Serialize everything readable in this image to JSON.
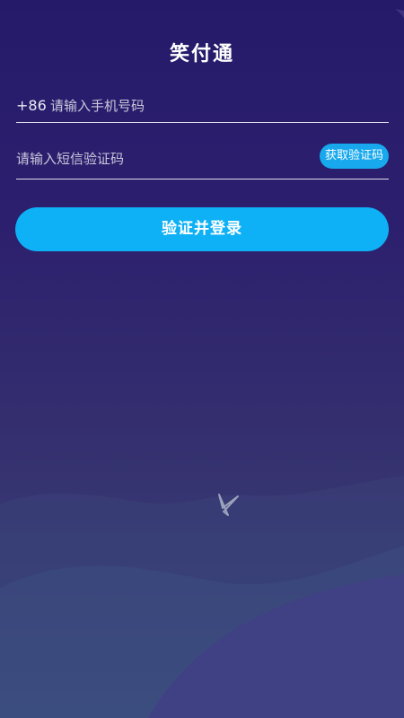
{
  "app": {
    "title": "笑付通"
  },
  "phone": {
    "country_code": "+86",
    "placeholder": "请输入手机号码",
    "value": ""
  },
  "sms": {
    "placeholder": "请输入短信验证码",
    "value": "",
    "button_label": "获取验证码"
  },
  "actions": {
    "submit_label": "验证并登录"
  },
  "colors": {
    "primary_button": "#0fb1f6",
    "code_button": "#17a8ee",
    "background_top": "#251a6a",
    "background_bottom": "#3a4a78"
  },
  "icons": {
    "decoration": "paper-plane-icon"
  }
}
